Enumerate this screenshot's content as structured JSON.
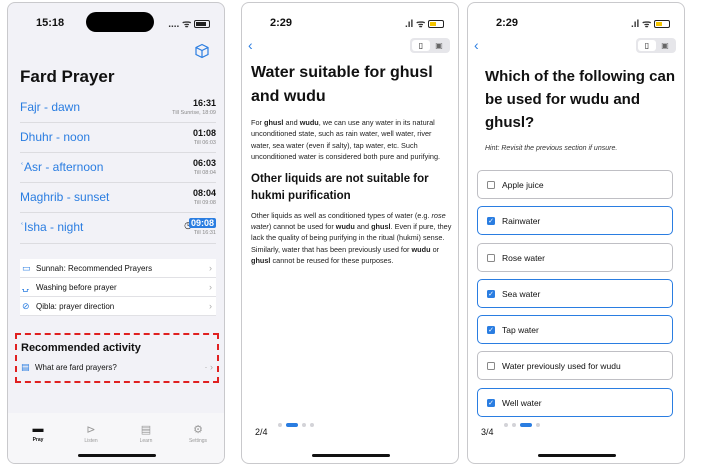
{
  "screen1": {
    "status_time": "15:18",
    "status_icons": ".... ᯤ",
    "title": "Fard Prayer",
    "prayers": [
      {
        "name": "Fajr - dawn",
        "time": "16:31",
        "sub": "Till Sunrise, 18:09"
      },
      {
        "name": "Dhuhr - noon",
        "time": "01:08",
        "sub": "Till 06:03"
      },
      {
        "name": "ʿAsr - afternoon",
        "time": "06:03",
        "sub": "Till 08:04"
      },
      {
        "name": "Maghrib - sunset",
        "time": "08:04",
        "sub": "Till 09:08"
      },
      {
        "name": "ʿIsha - night",
        "time": "09:08",
        "sub": "Till 16:31"
      }
    ],
    "links": [
      {
        "label": "Sunnah: Recommended Prayers",
        "icon": "calendar-icon"
      },
      {
        "label": "Washing before prayer",
        "icon": "tap-icon"
      },
      {
        "label": "Qibla: prayer direction",
        "icon": "compass-icon"
      }
    ],
    "recommended_title": "Recommended activity",
    "recommended_item": "What are fard prayers?",
    "tabs": [
      {
        "label": "Pray",
        "icon": "pray-icon"
      },
      {
        "label": "Listen",
        "icon": "play-icon"
      },
      {
        "label": "Learn",
        "icon": "book-icon"
      },
      {
        "label": "Settings",
        "icon": "gear-icon"
      }
    ]
  },
  "screen2": {
    "status_time": "2:29",
    "title": "Water suitable for ghusl and wudu",
    "para1_html": "For <b>ghusl</b> and <b>wudu</b>, we can use any water in its natural unconditioned state, such as rain water, well water, river water, sea water (even if salty), tap water, etc. Such unconditioned water is considered both pure and purifying.",
    "subtitle": "Other liquids are not suitable for hukmi purification",
    "para2_html": "Other liquids as well as conditioned types of water (e.g. <i>rose water</i>) cannot be used for <b>wudu</b> and <b>ghusl</b>. Even if pure, they lack the quality of being purifying in the ritual (hukmi) sense. Similarly, water that has been previously used for <b>wudu</b> or <b>ghusl</b> cannot be reused for these purposes.",
    "page": "2/4"
  },
  "screen3": {
    "status_time": "2:29",
    "question": "Which of the following can be used for wudu and ghusl?",
    "hint": "Hint: Revisit the previous section if unsure.",
    "options": [
      {
        "label": "Apple juice",
        "checked": false
      },
      {
        "label": "Rainwater",
        "checked": true
      },
      {
        "label": "Rose water",
        "checked": false
      },
      {
        "label": "Sea water",
        "checked": true
      },
      {
        "label": "Tap water",
        "checked": true
      },
      {
        "label": "Water previously used for wudu",
        "checked": false
      },
      {
        "label": "Well water",
        "checked": true
      }
    ],
    "page": "3/4"
  },
  "colors": {
    "accent": "#2a7de1",
    "highlight_box": "#e02020"
  }
}
